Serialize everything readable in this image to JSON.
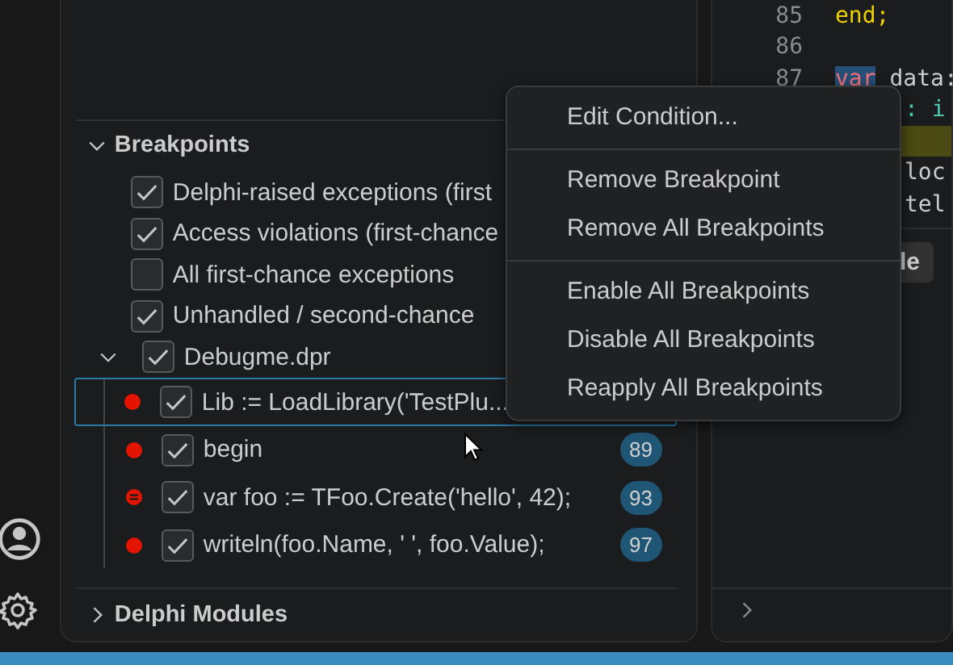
{
  "breakpoints": {
    "title": "Breakpoints",
    "expanded": true,
    "exceptions": [
      {
        "label": "Delphi-raised exceptions (first",
        "checked": true
      },
      {
        "label": "Access violations (first-chance",
        "checked": true
      },
      {
        "label": "All first-chance exceptions",
        "checked": false
      },
      {
        "label": "Unhandled / second-chance",
        "checked": true
      }
    ],
    "file": {
      "label": "Debugme.dpr",
      "checked": true,
      "expanded": true,
      "children": [
        {
          "kind": "plain",
          "text": "Lib := LoadLibrary('TestPlu...",
          "checked": true,
          "selected": true
        },
        {
          "kind": "plain",
          "text": "begin",
          "checked": true,
          "selected": false,
          "line": "89"
        },
        {
          "kind": "conditional",
          "text": "var foo := TFoo.Create('hello', 42);",
          "checked": true,
          "selected": false,
          "line": "93"
        },
        {
          "kind": "plain",
          "text": "writeln(foo.Name, ' ', foo.Value);",
          "checked": true,
          "selected": false,
          "line": "97"
        }
      ]
    }
  },
  "modules": {
    "title": "Delphi Modules",
    "expanded": false
  },
  "editor": {
    "lines": [
      {
        "number": "85",
        "code": "end;",
        "kind": "keyword"
      },
      {
        "number": "86"
      },
      {
        "number": "87",
        "code": "var data:",
        "kind": "decl"
      }
    ],
    "fragments": [
      {
        "code": ": i",
        "kind": "type"
      },
      {
        "kind": "highlight"
      },
      {
        "code": "loc",
        "kind": "plain"
      },
      {
        "code": "tel",
        "kind": "plain"
      }
    ],
    "button": "le"
  },
  "context_menu": {
    "groups": [
      [
        "Edit Condition..."
      ],
      [
        "Remove Breakpoint",
        "Remove All Breakpoints"
      ],
      [
        "Enable All Breakpoints",
        "Disable All Breakpoints",
        "Reapply All Breakpoints"
      ]
    ]
  }
}
